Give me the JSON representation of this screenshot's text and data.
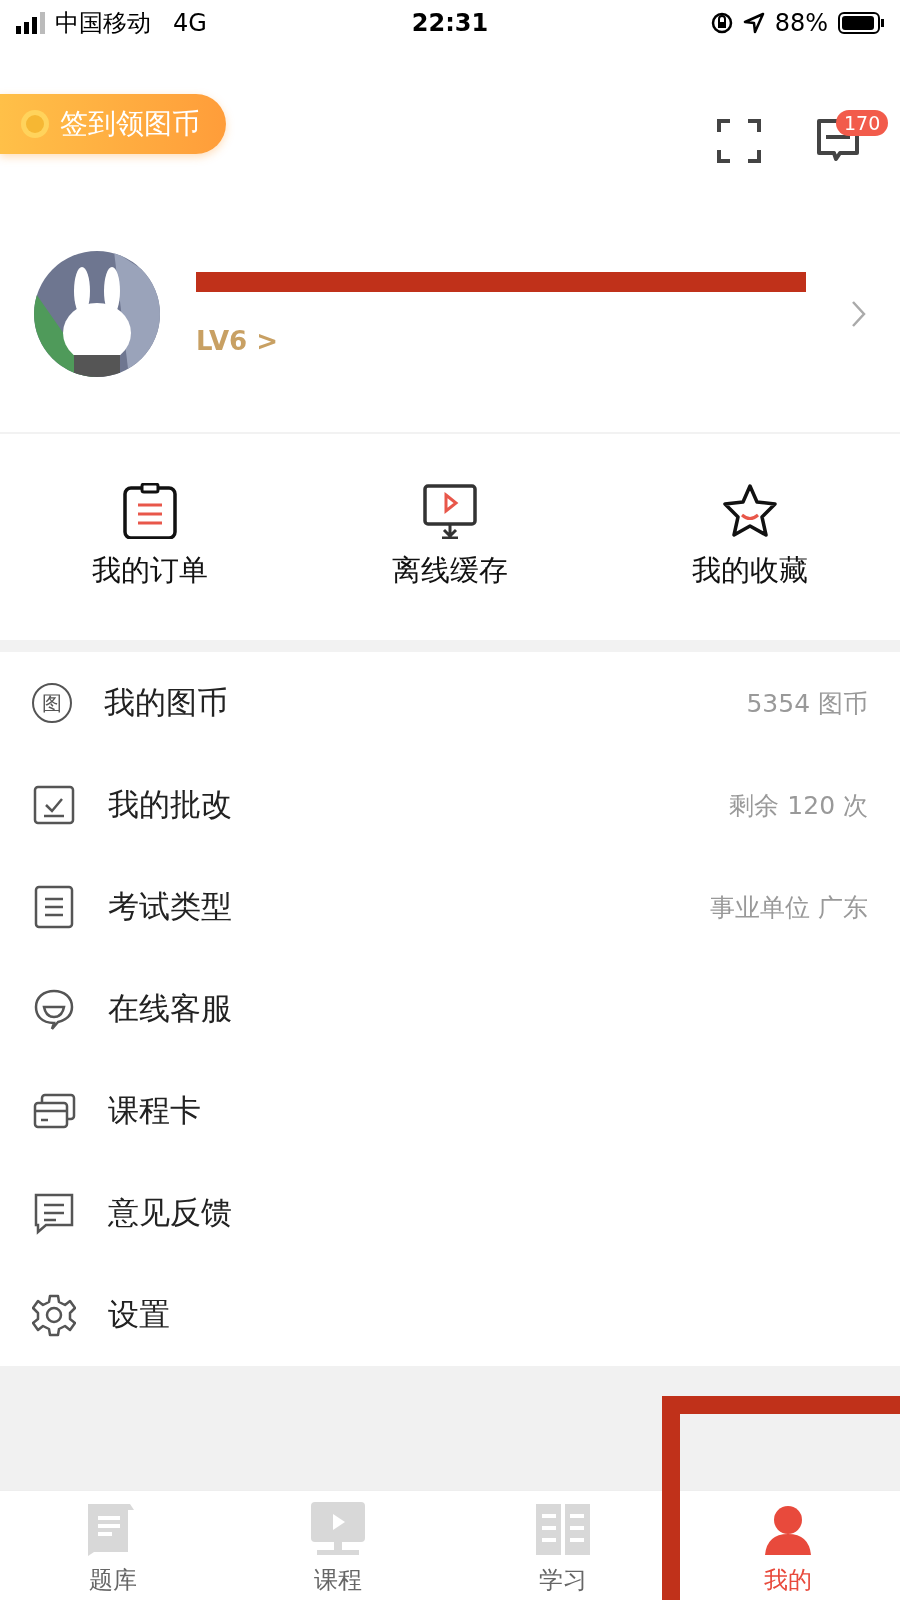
{
  "status_bar": {
    "carrier": "中国移动",
    "network": "4G",
    "time": "22:31",
    "battery": "88%"
  },
  "header": {
    "checkin_label": "签到领图币",
    "message_badge": "170"
  },
  "profile": {
    "level": "LV6 >"
  },
  "quick_actions": [
    {
      "label": "我的订单"
    },
    {
      "label": "离线缓存"
    },
    {
      "label": "我的收藏"
    }
  ],
  "menu": [
    {
      "label": "我的图币",
      "value": "5354 图币",
      "icon_glyph": "图"
    },
    {
      "label": "我的批改",
      "value": "剩余 120 次"
    },
    {
      "label": "考试类型",
      "value": "事业单位 广东"
    },
    {
      "label": "在线客服"
    },
    {
      "label": "课程卡"
    },
    {
      "label": "意见反馈"
    },
    {
      "label": "设置"
    }
  ],
  "tabs": [
    {
      "label": "题库",
      "selected": false
    },
    {
      "label": "课程",
      "selected": false
    },
    {
      "label": "学习",
      "selected": false
    },
    {
      "label": "我的",
      "selected": true
    }
  ]
}
